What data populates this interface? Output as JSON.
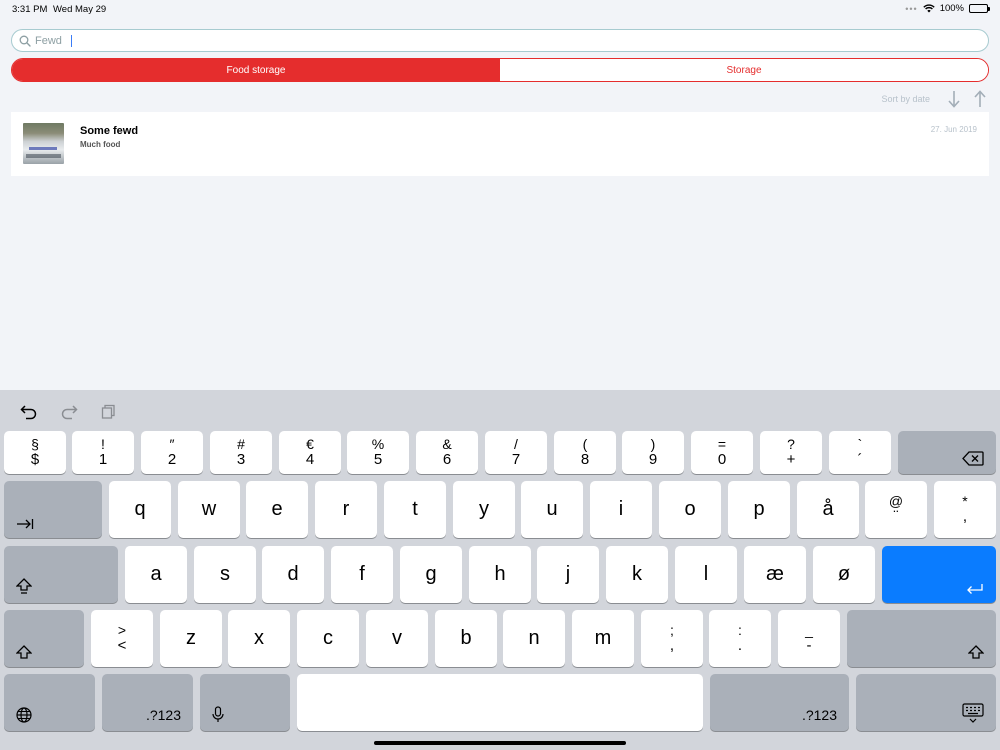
{
  "status": {
    "time": "3:31 PM",
    "date": "Wed May 29",
    "battery": "100%"
  },
  "search": {
    "value": "Fewd"
  },
  "tabs": [
    {
      "label": "Food storage"
    },
    {
      "label": "Storage"
    }
  ],
  "sort": {
    "label": "Sort by date"
  },
  "items": [
    {
      "title": "Some fewd",
      "subtitle": "Much food",
      "date": "27. Jun 2019"
    }
  ],
  "colors": {
    "accent": "#e52d2d",
    "return_key": "#0a7cff"
  },
  "keyboard": {
    "row1": [
      {
        "top": "§",
        "bot": "$"
      },
      {
        "top": "!",
        "bot": "1"
      },
      {
        "top": "″",
        "bot": "2"
      },
      {
        "top": "#",
        "bot": "3"
      },
      {
        "top": "€",
        "bot": "4"
      },
      {
        "top": "%",
        "bot": "5"
      },
      {
        "top": "&",
        "bot": "6"
      },
      {
        "top": "/",
        "bot": "7"
      },
      {
        "top": "(",
        "bot": "8"
      },
      {
        "top": ")",
        "bot": "9"
      },
      {
        "top": "=",
        "bot": "0"
      },
      {
        "top": "?",
        "bot": "+"
      },
      {
        "top": "`",
        "bot": "´"
      }
    ],
    "row2": [
      "q",
      "w",
      "e",
      "r",
      "t",
      "y",
      "u",
      "i",
      "o",
      "p",
      "å"
    ],
    "row2_extra": [
      {
        "top": "@",
        "bot": "¨"
      },
      {
        "top": "*",
        "bot": ","
      }
    ],
    "row3": [
      "a",
      "s",
      "d",
      "f",
      "g",
      "h",
      "j",
      "k",
      "l",
      "æ",
      "ø"
    ],
    "row4_angle": {
      "top": ">",
      "bot": "<"
    },
    "row4": [
      "z",
      "x",
      "c",
      "v",
      "b",
      "n",
      "m"
    ],
    "row4_punct": [
      {
        "top": ";",
        "bot": ","
      },
      {
        "top": ":",
        "bot": "."
      },
      {
        "top": "_",
        "bot": "-"
      }
    ],
    "numbers_label": ".?123"
  }
}
